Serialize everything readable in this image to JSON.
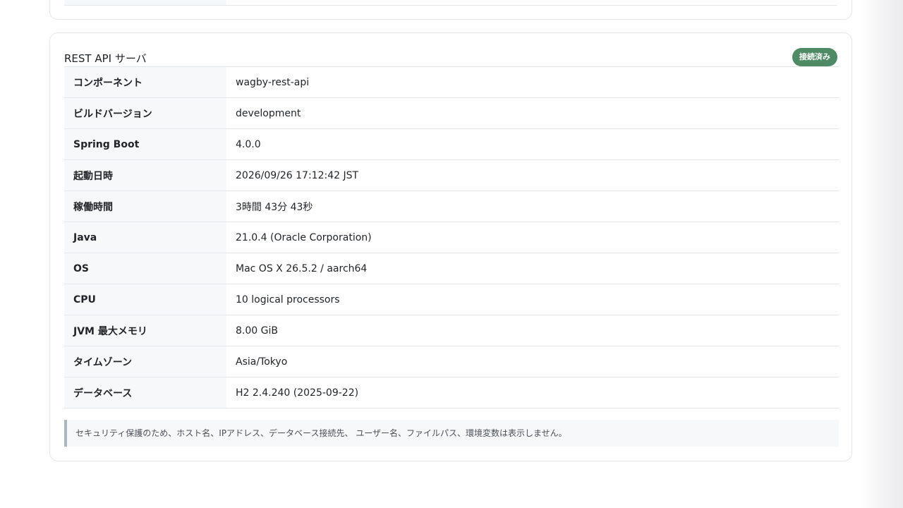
{
  "server_card": {
    "title": "REST API サーバ",
    "status_badge": "接続済み",
    "rows": [
      {
        "label": "コンポーネント",
        "value": "wagby-rest-api"
      },
      {
        "label": "ビルドバージョン",
        "value": "development"
      },
      {
        "label": "Spring Boot",
        "value": "4.0.0"
      },
      {
        "label": "起動日時",
        "value": "2026/09/26 17:12:42 JST"
      },
      {
        "label": "稼働時間",
        "value": "3時間 43分 43秒"
      },
      {
        "label": "Java",
        "value": "21.0.4 (Oracle Corporation)"
      },
      {
        "label": "OS",
        "value": "Mac OS X 26.5.2 / aarch64"
      },
      {
        "label": "CPU",
        "value": "10 logical processors"
      },
      {
        "label": "JVM 最大メモリ",
        "value": "8.00 GiB"
      },
      {
        "label": "タイムゾーン",
        "value": "Asia/Tokyo"
      },
      {
        "label": "データベース",
        "value": "H2 2.4.240 (2025-09-22)"
      }
    ],
    "security_note": "セキュリティ保護のため、ホスト名、IPアドレス、データベース接続先、 ユーザー名、ファイルパス、環境変数は表示しません。"
  },
  "colors": {
    "badge_background": "#4e8a63",
    "label_background": "#f7f8fa",
    "border": "#e3e6ea",
    "note_accent": "#adb5bd"
  }
}
